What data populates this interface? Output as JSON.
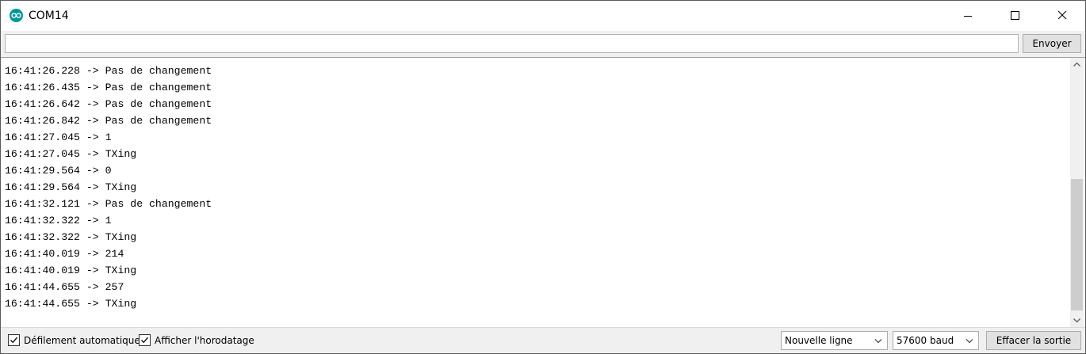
{
  "window": {
    "title": "COM14",
    "icon": "arduino-icon"
  },
  "input": {
    "value": "",
    "send_label": "Envoyer"
  },
  "output": {
    "lines": [
      "16:41:26.228 -> Pas de changement",
      "16:41:26.435 -> Pas de changement",
      "16:41:26.642 -> Pas de changement",
      "16:41:26.842 -> Pas de changement",
      "16:41:27.045 -> 1",
      "16:41:27.045 -> TXing",
      "16:41:29.564 -> 0",
      "16:41:29.564 -> TXing",
      "16:41:32.121 -> Pas de changement",
      "16:41:32.322 -> 1",
      "16:41:32.322 -> TXing",
      "16:41:40.019 -> 214",
      "16:41:40.019 -> TXing",
      "16:41:44.655 -> 257",
      "16:41:44.655 -> TXing"
    ]
  },
  "bottom": {
    "autoscroll_label": "Défilement automatique",
    "autoscroll_checked": true,
    "timestamp_label": "Afficher l'horodatage",
    "timestamp_checked": true,
    "line_ending": "Nouvelle ligne",
    "baud_rate": "57600 baud",
    "clear_label": "Effacer la sortie"
  }
}
